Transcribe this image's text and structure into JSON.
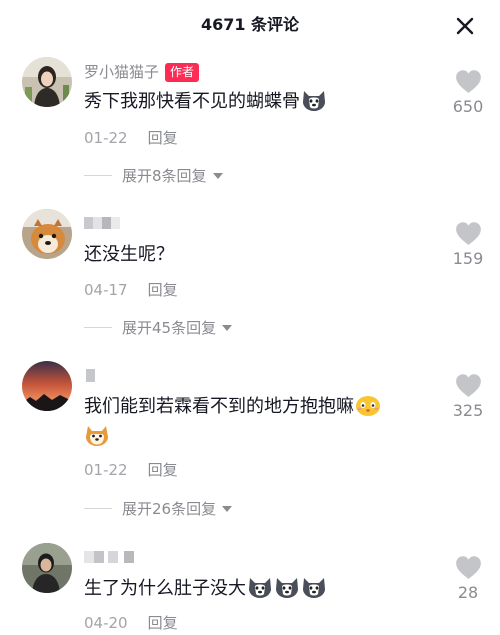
{
  "header": {
    "title": "4671 条评论"
  },
  "comments": [
    {
      "username": "罗小猫猫子",
      "badge": "作者",
      "text": "秀下我那快看不见的蝴蝶骨",
      "emojis": [
        "husky-emoji"
      ],
      "date": "01-22",
      "reply_label": "回复",
      "expand_label": "展开8条回复",
      "likes": "650"
    },
    {
      "username": "",
      "text": "还没生呢？",
      "emojis": [],
      "date": "04-17",
      "reply_label": "回复",
      "expand_label": "展开45条回复",
      "likes": "159"
    },
    {
      "username": "",
      "text": "我们能到若霖看不到的地方抱抱嘛",
      "emojis": [
        "shy-face-emoji",
        "shiba-emoji"
      ],
      "date": "01-22",
      "reply_label": "回复",
      "expand_label": "展开26条回复",
      "likes": "325"
    },
    {
      "username": "",
      "text": "生了为什么肚子没大",
      "emojis": [
        "husky-emoji",
        "husky-emoji",
        "husky-emoji"
      ],
      "date": "04-20",
      "reply_label": "回复",
      "likes": "28"
    }
  ],
  "colors": {
    "badge": "#fe2c55",
    "text": "#161823",
    "secondary": "#8a8b91",
    "heart": "#c4c5c9"
  }
}
